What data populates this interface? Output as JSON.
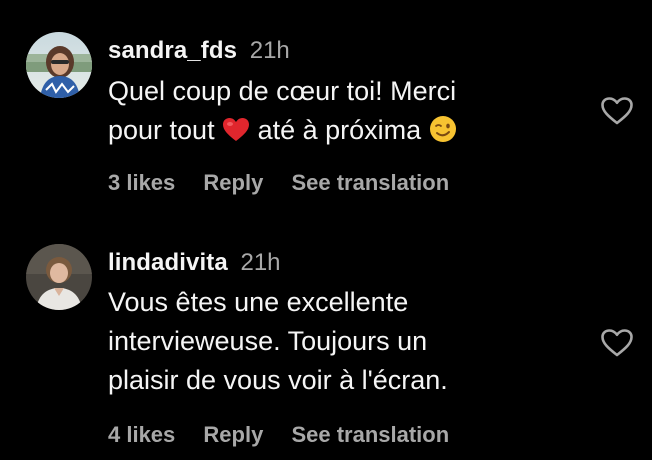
{
  "comments": [
    {
      "username": "sandra_fds",
      "timestamp": "21h",
      "lines": [
        "Quel coup de cœur toi! Merci",
        "pour tout",
        "até à próxima"
      ],
      "emojis": [
        "red-heart-emoji",
        "winking-face-emoji"
      ],
      "likes": "3 likes",
      "reply": "Reply",
      "translate": "See translation"
    },
    {
      "username": "lindadivita",
      "timestamp": "21h",
      "lines": [
        "Vous êtes une excellente",
        "intervieweuse. Toujours un",
        "plaisir de vous voir à l'écran."
      ],
      "likes": "4 likes",
      "reply": "Reply",
      "translate": "See translation"
    }
  ],
  "colors": {
    "background": "#000000",
    "primary_text": "#f5f5f5",
    "secondary_text": "#a8a8a8",
    "heart_emoji": "#e0262d",
    "wink_emoji": "#f7c331"
  },
  "icons": {
    "like": "heart-outline-icon"
  }
}
